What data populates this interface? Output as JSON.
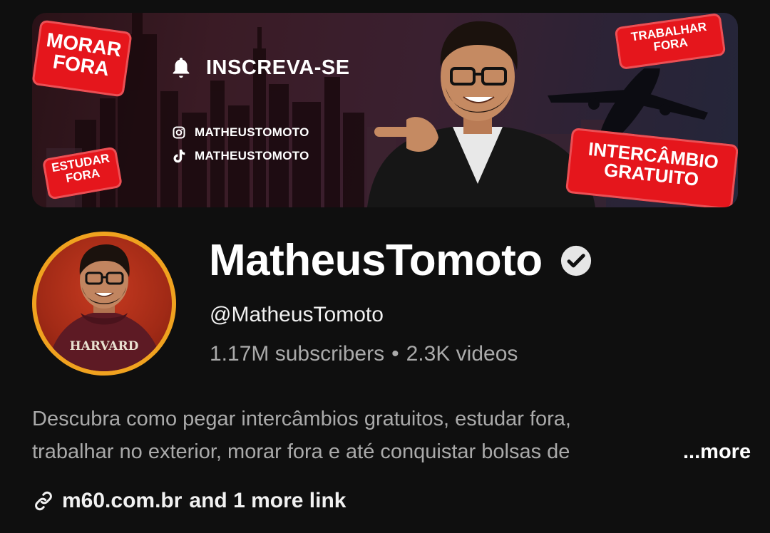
{
  "banner": {
    "stickers": {
      "morar_fora": "MORAR\nFORA",
      "estudar_fora": "ESTUDAR\nFORA",
      "trabalhar_fora": "TRABALHAR\nFORA",
      "intercambio": "INTERCÂMBIO\nGRATUITO"
    },
    "cta": "INSCREVA-SE",
    "instagram_handle": "MATHEUSTOMOTO",
    "tiktok_handle": "MATHEUSTOMOTO"
  },
  "channel": {
    "name": "MatheusTomoto",
    "handle": "@MatheusTomoto",
    "subscribers": "1.17M subscribers",
    "separator": "•",
    "videos": "2.3K videos",
    "avatar_text": "HARVARD"
  },
  "description": {
    "line1": "Descubra como pegar intercâmbios gratuitos, estudar fora,",
    "line2": "trabalhar no exterior, morar fora e até conquistar bolsas de",
    "more_label": "...more"
  },
  "links": {
    "primary": "m60.com.br",
    "extra": "and 1 more link"
  },
  "colors": {
    "background": "#0f0f0f",
    "avatar_ring": "#f0a21f",
    "sticker_red": "#e5161c",
    "secondary_text": "#aaaaaa"
  }
}
